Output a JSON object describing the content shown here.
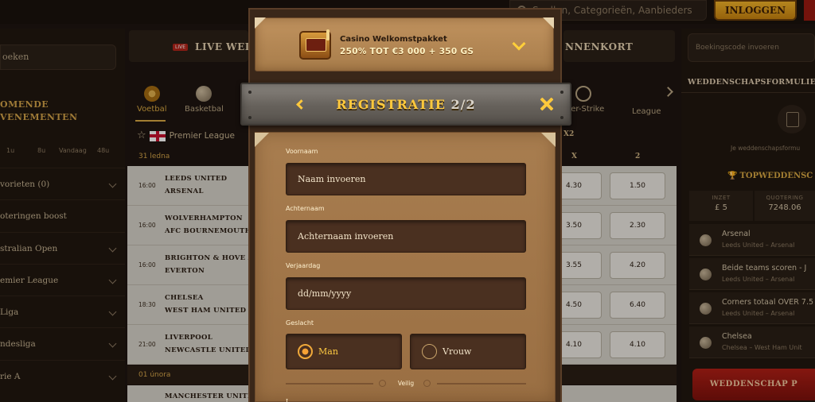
{
  "header": {
    "search_placeholder": "Spellen, Categorieën, Aanbieders",
    "login_label": "INLOGGEN"
  },
  "sidebar": {
    "search_placeholder": "oeken",
    "heading_line1": "OMENDE",
    "heading_line2": "VENEMENTEN",
    "filters": [
      "1u",
      "8u",
      "Vandaag",
      "48u"
    ],
    "items": [
      {
        "label": "vorieten (0)"
      },
      {
        "label": "oteringen boost"
      },
      {
        "label": "stralian Open"
      },
      {
        "label": "emier League"
      },
      {
        "label": "Liga"
      },
      {
        "label": "ndesliga"
      },
      {
        "label": "rie A"
      }
    ]
  },
  "events": {
    "live_badge": "LIVE",
    "live_label": "LIVE WEDD",
    "soon_label": "NNENKORT",
    "sports": [
      {
        "label": "Voetbal"
      },
      {
        "label": "Basketbal"
      },
      {
        "label": "nter-Strike"
      },
      {
        "label": "League"
      }
    ],
    "league": "Premier League",
    "market_label": "X2",
    "col_x": "X",
    "col_2": "2",
    "date1": "31 ledna",
    "date2": "01 února",
    "rows": [
      {
        "time": "16:00",
        "team1": "LEEDS UNITED",
        "team2": "ARSENAL",
        "x": "4.30",
        "two": "1.50"
      },
      {
        "time": "16:00",
        "team1": "WOLVERHAMPTON",
        "team2": "AFC BOURNEMOUTH",
        "x": "3.50",
        "two": "2.30"
      },
      {
        "time": "16:00",
        "team1": "BRIGHTON & HOVE AL",
        "team2": "EVERTON",
        "x": "3.55",
        "two": "4.20"
      },
      {
        "time": "18:30",
        "team1": "CHELSEA",
        "team2": "WEST HAM UNITED",
        "x": "4.50",
        "two": "6.40"
      },
      {
        "time": "21:00",
        "team1": "LIVERPOOL",
        "team2": "NEWCASTLE UNITED",
        "x": "4.10",
        "two": "4.10"
      }
    ],
    "next_row_team": "MANCHESTER UNITED"
  },
  "betslip": {
    "booking_placeholder": "Boekingscode invoeren",
    "title": "WEDDENSCHAPSFORMULIER (",
    "empty_text": "Je weddenschapsformu",
    "top_title": "TOPWEDDENSC",
    "stake_label": "INZET",
    "stake_value": "£ 5",
    "quot_label": "QUOTERING",
    "quot_value": "7248.06",
    "legs": [
      {
        "l1": "Arsenal",
        "l2": "Leeds United – Arsenal"
      },
      {
        "l1": "Beide teams scoren - J",
        "l2": "Leeds United – Arsenal"
      },
      {
        "l1": "Corners totaal OVER 7.5",
        "l2": "Leeds United – Arsenal"
      },
      {
        "l1": "Chelsea",
        "l2": "Chelsea – West Ham Unit"
      }
    ],
    "place_label": "WEDDENSCHAP P"
  },
  "modal": {
    "promo_title": "Casino Welkomstpakket",
    "promo_sub": "250% TOT €3 000 + 350 GS",
    "reg_title": "REGISTRATIE",
    "reg_step": "2/2",
    "fields": {
      "firstname_label": "Voornaam",
      "firstname_placeholder": "Naam invoeren",
      "lastname_label": "Achternaam",
      "lastname_placeholder": "Achternaam invoeren",
      "birthday_label": "Verjaardag",
      "birthday_placeholder": "dd/mm/yyyy",
      "gender_label": "Geslacht",
      "gender_male": "Man",
      "gender_female": "Vrouw"
    },
    "divider_text": "Veilig",
    "next_label": "L",
    "gender_selected": "male"
  },
  "colors": {
    "accent_gold": "#ffc93c",
    "panel_wood": "#a87d4f",
    "input_dark": "#4a3020",
    "cta_red": "#b11f16"
  }
}
